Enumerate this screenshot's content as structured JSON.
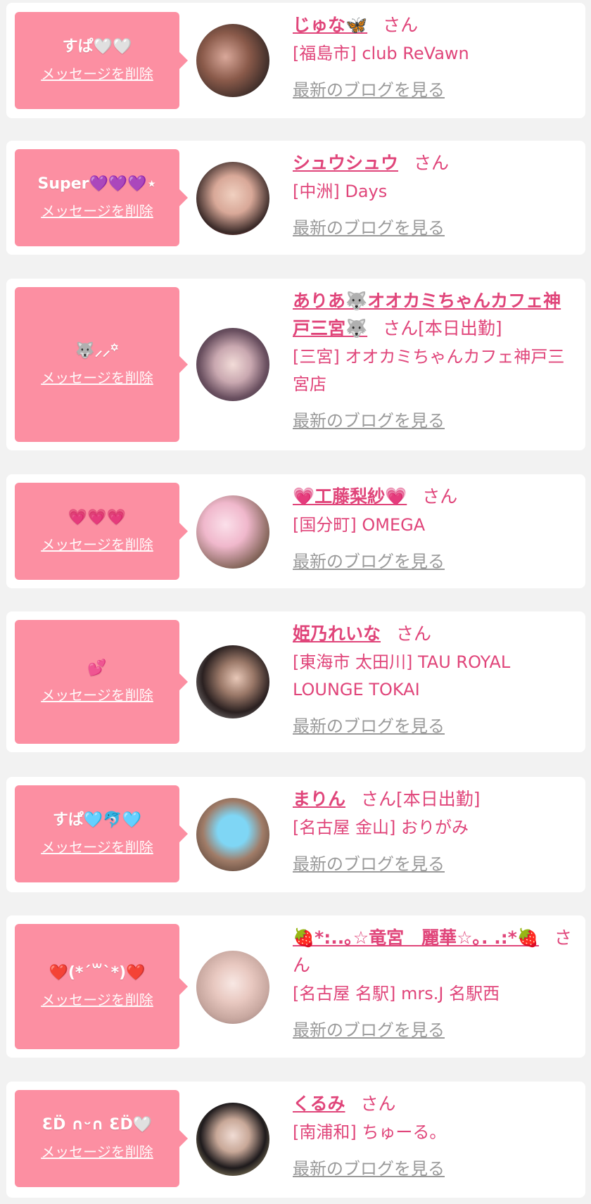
{
  "colors": {
    "accent_pink": "#fc8fa2",
    "name_pink": "#e0457a",
    "link_gray": "#9a9a9a",
    "background": "#f2f2f2"
  },
  "delete_label": "メッセージを削除",
  "blog_label": "最新のブログを見る",
  "san_label": "さん",
  "entries": [
    {
      "message": "すぱ🤍🤍",
      "name": "じゅな🦋",
      "suffix": "",
      "shop": "[福島市] club ReVawn"
    },
    {
      "message": "Super💜💜💜⋆",
      "name": "シュウシュウ",
      "suffix": "",
      "shop": "[中洲] Days"
    },
    {
      "message": "🐺⸝⸝꙳",
      "name": "ありあ🐺オオカミちゃんカフェ神戸三宮🐺",
      "suffix": "[本日出勤]",
      "shop": "[三宮] オオカミちゃんカフェ神戸三宮店"
    },
    {
      "message": "💗💗💗",
      "name": "💗工藤梨紗💗",
      "suffix": "",
      "shop": "[国分町] OMEGA"
    },
    {
      "message": "💕",
      "name": "姫乃れいな",
      "suffix": "",
      "shop": "[東海市 太田川] TAU ROYAL LOUNGE TOKAI"
    },
    {
      "message": "すぱ🩵🐬🩵",
      "name": "まりん",
      "suffix": "[本日出勤]",
      "shop": "[名古屋 金山] おりがみ"
    },
    {
      "message": "❤️(*´꒳`*)❤️",
      "name": "🍓*:..｡☆竜宮　麗華☆｡. .:*🍓",
      "suffix": "",
      "shop": "[名古屋 名駅] mrs.J 名駅西"
    },
    {
      "message": "ƐD̈ ∩ᵕ∩ ƐD̈🤍",
      "name": "くるみ",
      "suffix": "",
      "shop": "[南浦和] ちゅーる。"
    }
  ]
}
